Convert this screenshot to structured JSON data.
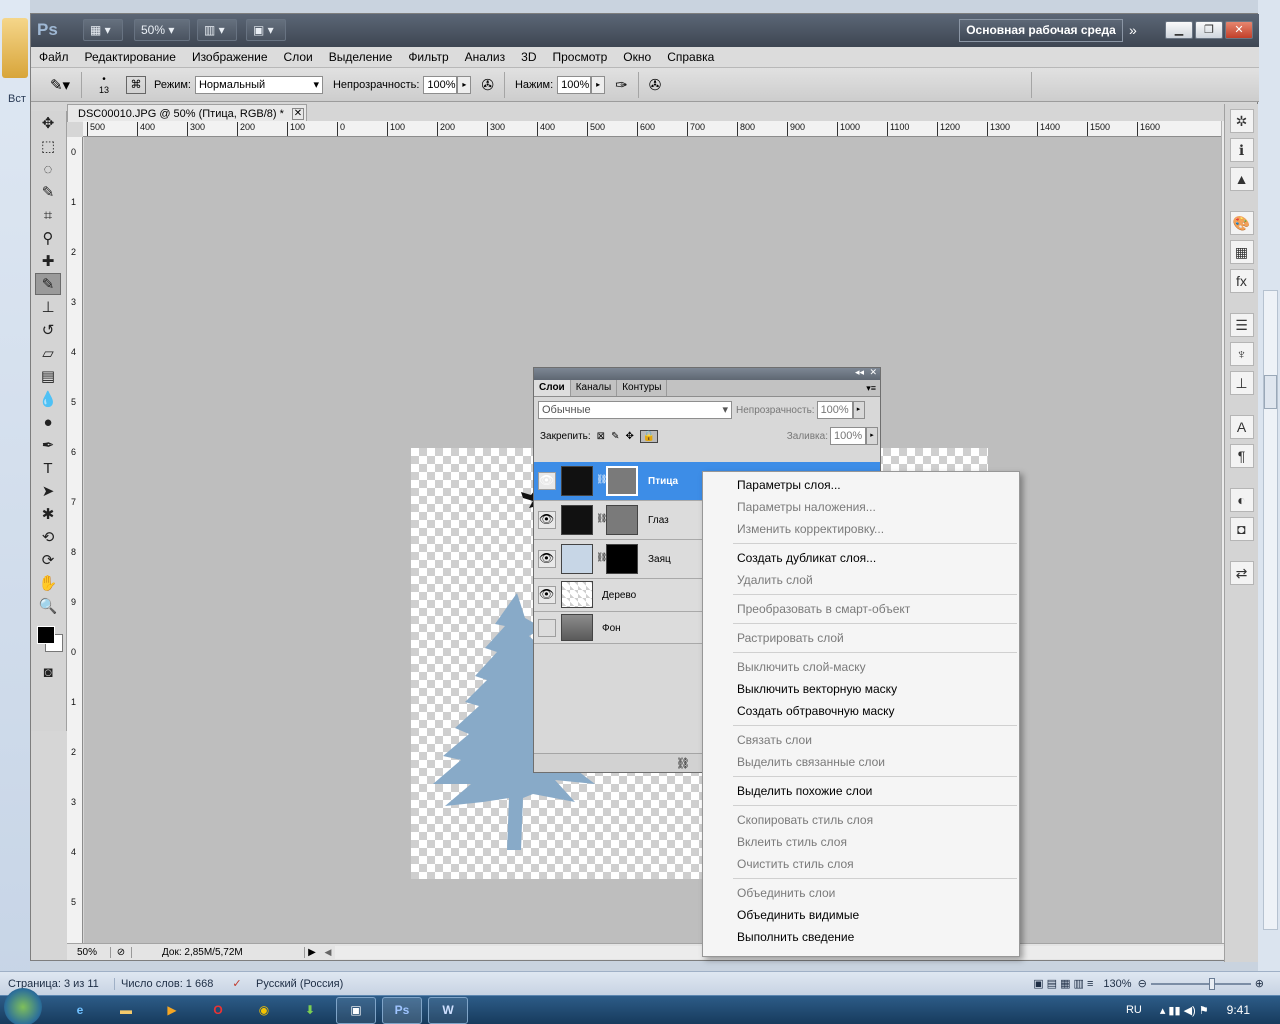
{
  "photoshop": {
    "logo": "Ps",
    "zoom": "50%",
    "workspace_button": "Основная рабочая среда",
    "menu": [
      "Файл",
      "Редактирование",
      "Изображение",
      "Слои",
      "Выделение",
      "Фильтр",
      "Анализ",
      "3D",
      "Просмотр",
      "Окно",
      "Справка"
    ],
    "options": {
      "brush_size": "13",
      "mode_label": "Режим:",
      "mode_value": "Нормальный",
      "opacity_label": "Непрозрачность:",
      "opacity_value": "100%",
      "flow_label": "Нажим:",
      "flow_value": "100%"
    },
    "document_tab": "DSC00010.JPG @ 50% (Птица, RGB/8) *",
    "ruler_h": [
      "500",
      "400",
      "300",
      "200",
      "100",
      "0",
      "100",
      "200",
      "300",
      "400",
      "500",
      "600",
      "700",
      "800",
      "900",
      "1000",
      "1100",
      "1200",
      "1300",
      "1400",
      "1500",
      "1600"
    ],
    "ruler_v": [
      "0",
      "1",
      "2",
      "3",
      "4",
      "5",
      "6",
      "7",
      "8",
      "9",
      "0",
      "1",
      "2",
      "3",
      "4",
      "5"
    ],
    "status": {
      "zoom": "50%",
      "doc": "Док: 2,85M/5,72M"
    }
  },
  "layers_panel": {
    "tabs": [
      "Слои",
      "Каналы",
      "Контуры"
    ],
    "blend_mode": "Обычные",
    "opacity_label": "Непрозрачность:",
    "opacity_value": "100%",
    "lock_label": "Закрепить:",
    "fill_label": "Заливка:",
    "fill_value": "100%",
    "layers": [
      {
        "name": "Птица",
        "selected": true,
        "visible": true
      },
      {
        "name": "Глаз",
        "selected": false,
        "visible": true
      },
      {
        "name": "Заяц",
        "selected": false,
        "visible": true
      },
      {
        "name": "Дерево",
        "selected": false,
        "visible": true
      },
      {
        "name": "Фон",
        "selected": false,
        "visible": false
      }
    ]
  },
  "context_menu": {
    "items": [
      {
        "label": "Параметры слоя...",
        "enabled": true
      },
      {
        "label": "Параметры наложения...",
        "enabled": false
      },
      {
        "label": "Изменить корректировку...",
        "enabled": false
      },
      {
        "label": "Создать дубликат слоя...",
        "enabled": true
      },
      {
        "label": "Удалить слой",
        "enabled": false
      },
      {
        "label": "Преобразовать в смарт-объект",
        "enabled": false
      },
      {
        "label": "Растрировать слой",
        "enabled": false
      },
      {
        "label": "Выключить слой-маску",
        "enabled": false
      },
      {
        "label": "Выключить векторную маску",
        "enabled": true
      },
      {
        "label": "Создать обтравочную маску",
        "enabled": true
      },
      {
        "label": "Связать слои",
        "enabled": false
      },
      {
        "label": "Выделить связанные слои",
        "enabled": false
      },
      {
        "label": "Выделить похожие слои",
        "enabled": true
      },
      {
        "label": "Скопировать стиль слоя",
        "enabled": false
      },
      {
        "label": "Вклеить стиль слоя",
        "enabled": false
      },
      {
        "label": "Очистить стиль слоя",
        "enabled": false
      },
      {
        "label": "Объединить слои",
        "enabled": false
      },
      {
        "label": "Объединить видимые",
        "enabled": true
      },
      {
        "label": "Выполнить сведение",
        "enabled": true
      }
    ]
  },
  "word": {
    "left_label": "Вст",
    "status_page": "Страница: 3 из 11",
    "status_words": "Число слов: 1 668",
    "status_lang": "Русский (Россия)",
    "zoom": "130%"
  },
  "taskbar": {
    "lang": "RU",
    "time": "9:41"
  },
  "colors": {
    "selection_blue": "#3d8de7",
    "tree_blue": "#88aac8",
    "ps_chrome": "#4a5360"
  }
}
